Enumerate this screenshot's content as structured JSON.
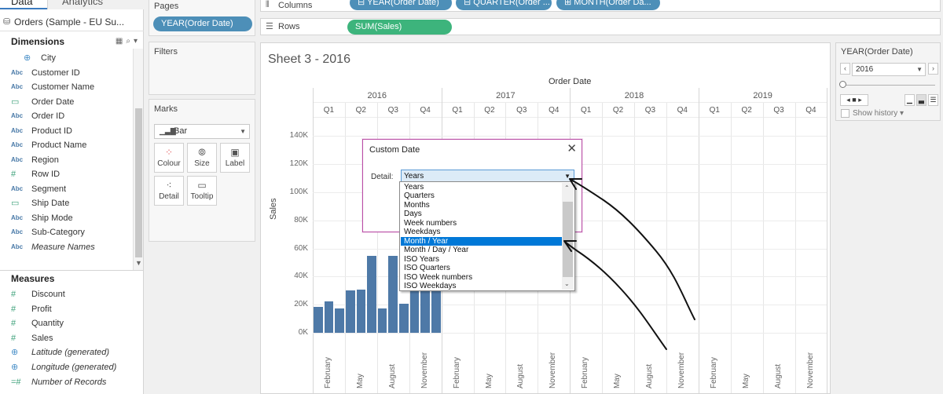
{
  "data_pane": {
    "tabs": [
      "Data",
      "Analytics"
    ],
    "datasource": "Orders (Sample - EU Su...",
    "dimensions_title": "Dimensions",
    "dimensions": [
      {
        "type": "geo",
        "label": "City"
      },
      {
        "type": "Abc",
        "label": "Customer ID"
      },
      {
        "type": "Abc",
        "label": "Customer Name"
      },
      {
        "type": "date",
        "label": "Order Date"
      },
      {
        "type": "Abc",
        "label": "Order ID"
      },
      {
        "type": "Abc",
        "label": "Product ID"
      },
      {
        "type": "Abc",
        "label": "Product Name"
      },
      {
        "type": "Abc",
        "label": "Region"
      },
      {
        "type": "#",
        "label": "Row ID"
      },
      {
        "type": "Abc",
        "label": "Segment"
      },
      {
        "type": "date",
        "label": "Ship Date"
      },
      {
        "type": "Abc",
        "label": "Ship Mode"
      },
      {
        "type": "Abc",
        "label": "Sub-Category"
      },
      {
        "type": "Abc",
        "label": "Measure Names"
      }
    ],
    "measures_title": "Measures",
    "measures": [
      {
        "type": "#",
        "label": "Discount"
      },
      {
        "type": "#",
        "label": "Profit"
      },
      {
        "type": "#",
        "label": "Quantity"
      },
      {
        "type": "#",
        "label": "Sales"
      },
      {
        "type": "geo",
        "label": "Latitude (generated)"
      },
      {
        "type": "geo",
        "label": "Longitude (generated)"
      },
      {
        "type": "=#",
        "label": "Number of Records"
      }
    ]
  },
  "cards": {
    "pages_title": "Pages",
    "pages_pill": "YEAR(Order Date)",
    "filters_title": "Filters",
    "marks_title": "Marks",
    "mark_type": "Bar",
    "mark_buttons": [
      "Colour",
      "Size",
      "Label",
      "Detail",
      "Tooltip"
    ]
  },
  "shelves": {
    "columns_label": "Columns",
    "column_pills": [
      "YEAR(Order Date)",
      "QUARTER(Order ...",
      "MONTH(Order Da..."
    ],
    "rows_label": "Rows",
    "row_pills": [
      "SUM(Sales)"
    ]
  },
  "sheet": {
    "title": "Sheet 3 - 2016",
    "header_title": "Order Date",
    "years": [
      "2016",
      "2017",
      "2018",
      "2019"
    ],
    "quarters": [
      "Q1",
      "Q2",
      "Q3",
      "Q4"
    ],
    "y_ticks": [
      "140K",
      "120K",
      "100K",
      "80K",
      "60K",
      "40K",
      "20K",
      "0K"
    ],
    "y_title": "Sales",
    "month_labels": [
      "February",
      "May",
      "August",
      "November"
    ]
  },
  "chart_data": {
    "type": "bar",
    "ylabel": "Sales",
    "ylim": [
      0,
      140000
    ],
    "x_axis": "Order Date (Year / Quarter / Month)",
    "categories": [
      "2016-Jan",
      "2016-Feb",
      "2016-Mar",
      "2016-Apr",
      "2016-May",
      "2016-Jun",
      "2016-Jul",
      "2016-Aug",
      "2016-Sep",
      "2016-Oct",
      "2016-Nov",
      "2016-Dec"
    ],
    "values": [
      18500,
      22500,
      17500,
      30000,
      30500,
      54500,
      17500,
      55000,
      20500,
      60000,
      60000,
      60000
    ]
  },
  "page_control": {
    "title": "YEAR(Order Date)",
    "value": "2016",
    "show_history": "Show history"
  },
  "dialog": {
    "title": "Custom Date",
    "detail_label": "Detail:",
    "selected": "Years",
    "options": [
      "Years",
      "Quarters",
      "Months",
      "Days",
      "Week numbers",
      "Weekdays",
      "Month / Year",
      "Month / Day / Year",
      "ISO Years",
      "ISO Quarters",
      "ISO Week numbers",
      "ISO Weekdays"
    ],
    "highlighted": "Month / Year"
  },
  "colors": {
    "bar": "#4e79a7",
    "pill_blue": "#4d8fb8",
    "pill_green": "#3db47c",
    "dialog_border": "#b94ea6",
    "selection": "#0078d7"
  }
}
